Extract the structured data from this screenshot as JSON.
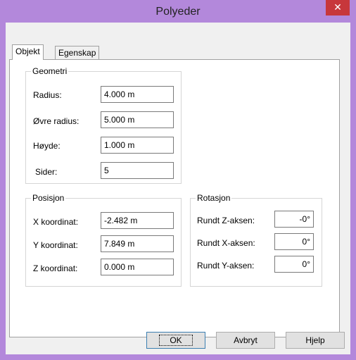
{
  "window": {
    "title": "Polyeder",
    "close_glyph": "✕"
  },
  "tabs": [
    {
      "label": "Objekt",
      "active": true
    },
    {
      "label": "Egenskap",
      "active": false
    }
  ],
  "geometri": {
    "title": "Geometri",
    "fields": [
      {
        "label": "Radius:",
        "value": "4.000 m"
      },
      {
        "label": "Øvre radius:",
        "value": "5.000 m"
      },
      {
        "label": "Høyde:",
        "value": "1.000 m"
      },
      {
        "label": "Sider:",
        "value": "5"
      }
    ]
  },
  "posisjon": {
    "title": "Posisjon",
    "fields": [
      {
        "label": "X koordinat:",
        "value": "-2.482 m"
      },
      {
        "label": "Y koordinat:",
        "value": "7.849 m"
      },
      {
        "label": "Z koordinat:",
        "value": "0.000 m"
      }
    ]
  },
  "rotasjon": {
    "title": "Rotasjon",
    "fields": [
      {
        "label": "Rundt Z-aksen:",
        "value": "-0°"
      },
      {
        "label": "Rundt X-aksen:",
        "value": "0°"
      },
      {
        "label": "Rundt Y-aksen:",
        "value": "0°"
      }
    ]
  },
  "buttons": {
    "ok": "OK",
    "cancel": "Avbryt",
    "help": "Hjelp"
  },
  "colors": {
    "titlebar": "#b388db",
    "close": "#c7373b",
    "dialog_bg": "#f0f0f0"
  }
}
